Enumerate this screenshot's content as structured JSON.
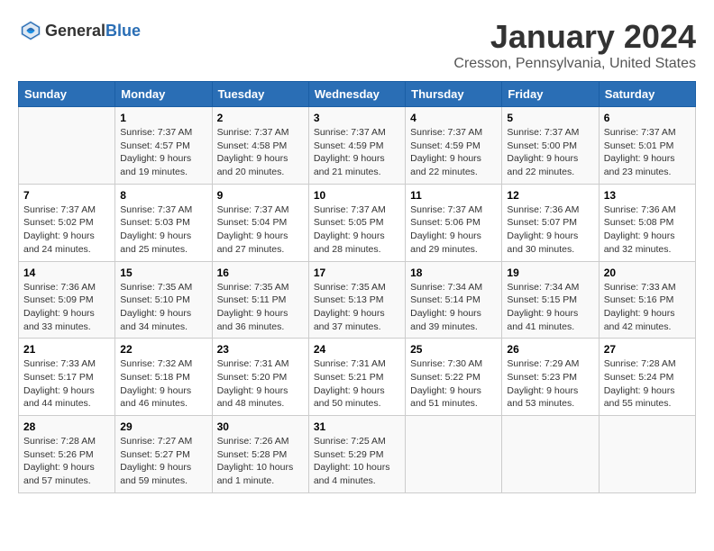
{
  "header": {
    "logo_general": "General",
    "logo_blue": "Blue",
    "title": "January 2024",
    "subtitle": "Cresson, Pennsylvania, United States"
  },
  "weekdays": [
    "Sunday",
    "Monday",
    "Tuesday",
    "Wednesday",
    "Thursday",
    "Friday",
    "Saturday"
  ],
  "weeks": [
    [
      {
        "day": "",
        "info": ""
      },
      {
        "day": "1",
        "info": "Sunrise: 7:37 AM\nSunset: 4:57 PM\nDaylight: 9 hours\nand 19 minutes."
      },
      {
        "day": "2",
        "info": "Sunrise: 7:37 AM\nSunset: 4:58 PM\nDaylight: 9 hours\nand 20 minutes."
      },
      {
        "day": "3",
        "info": "Sunrise: 7:37 AM\nSunset: 4:59 PM\nDaylight: 9 hours\nand 21 minutes."
      },
      {
        "day": "4",
        "info": "Sunrise: 7:37 AM\nSunset: 4:59 PM\nDaylight: 9 hours\nand 22 minutes."
      },
      {
        "day": "5",
        "info": "Sunrise: 7:37 AM\nSunset: 5:00 PM\nDaylight: 9 hours\nand 22 minutes."
      },
      {
        "day": "6",
        "info": "Sunrise: 7:37 AM\nSunset: 5:01 PM\nDaylight: 9 hours\nand 23 minutes."
      }
    ],
    [
      {
        "day": "7",
        "info": "Sunrise: 7:37 AM\nSunset: 5:02 PM\nDaylight: 9 hours\nand 24 minutes."
      },
      {
        "day": "8",
        "info": "Sunrise: 7:37 AM\nSunset: 5:03 PM\nDaylight: 9 hours\nand 25 minutes."
      },
      {
        "day": "9",
        "info": "Sunrise: 7:37 AM\nSunset: 5:04 PM\nDaylight: 9 hours\nand 27 minutes."
      },
      {
        "day": "10",
        "info": "Sunrise: 7:37 AM\nSunset: 5:05 PM\nDaylight: 9 hours\nand 28 minutes."
      },
      {
        "day": "11",
        "info": "Sunrise: 7:37 AM\nSunset: 5:06 PM\nDaylight: 9 hours\nand 29 minutes."
      },
      {
        "day": "12",
        "info": "Sunrise: 7:36 AM\nSunset: 5:07 PM\nDaylight: 9 hours\nand 30 minutes."
      },
      {
        "day": "13",
        "info": "Sunrise: 7:36 AM\nSunset: 5:08 PM\nDaylight: 9 hours\nand 32 minutes."
      }
    ],
    [
      {
        "day": "14",
        "info": "Sunrise: 7:36 AM\nSunset: 5:09 PM\nDaylight: 9 hours\nand 33 minutes."
      },
      {
        "day": "15",
        "info": "Sunrise: 7:35 AM\nSunset: 5:10 PM\nDaylight: 9 hours\nand 34 minutes."
      },
      {
        "day": "16",
        "info": "Sunrise: 7:35 AM\nSunset: 5:11 PM\nDaylight: 9 hours\nand 36 minutes."
      },
      {
        "day": "17",
        "info": "Sunrise: 7:35 AM\nSunset: 5:13 PM\nDaylight: 9 hours\nand 37 minutes."
      },
      {
        "day": "18",
        "info": "Sunrise: 7:34 AM\nSunset: 5:14 PM\nDaylight: 9 hours\nand 39 minutes."
      },
      {
        "day": "19",
        "info": "Sunrise: 7:34 AM\nSunset: 5:15 PM\nDaylight: 9 hours\nand 41 minutes."
      },
      {
        "day": "20",
        "info": "Sunrise: 7:33 AM\nSunset: 5:16 PM\nDaylight: 9 hours\nand 42 minutes."
      }
    ],
    [
      {
        "day": "21",
        "info": "Sunrise: 7:33 AM\nSunset: 5:17 PM\nDaylight: 9 hours\nand 44 minutes."
      },
      {
        "day": "22",
        "info": "Sunrise: 7:32 AM\nSunset: 5:18 PM\nDaylight: 9 hours\nand 46 minutes."
      },
      {
        "day": "23",
        "info": "Sunrise: 7:31 AM\nSunset: 5:20 PM\nDaylight: 9 hours\nand 48 minutes."
      },
      {
        "day": "24",
        "info": "Sunrise: 7:31 AM\nSunset: 5:21 PM\nDaylight: 9 hours\nand 50 minutes."
      },
      {
        "day": "25",
        "info": "Sunrise: 7:30 AM\nSunset: 5:22 PM\nDaylight: 9 hours\nand 51 minutes."
      },
      {
        "day": "26",
        "info": "Sunrise: 7:29 AM\nSunset: 5:23 PM\nDaylight: 9 hours\nand 53 minutes."
      },
      {
        "day": "27",
        "info": "Sunrise: 7:28 AM\nSunset: 5:24 PM\nDaylight: 9 hours\nand 55 minutes."
      }
    ],
    [
      {
        "day": "28",
        "info": "Sunrise: 7:28 AM\nSunset: 5:26 PM\nDaylight: 9 hours\nand 57 minutes."
      },
      {
        "day": "29",
        "info": "Sunrise: 7:27 AM\nSunset: 5:27 PM\nDaylight: 9 hours\nand 59 minutes."
      },
      {
        "day": "30",
        "info": "Sunrise: 7:26 AM\nSunset: 5:28 PM\nDaylight: 10 hours\nand 1 minute."
      },
      {
        "day": "31",
        "info": "Sunrise: 7:25 AM\nSunset: 5:29 PM\nDaylight: 10 hours\nand 4 minutes."
      },
      {
        "day": "",
        "info": ""
      },
      {
        "day": "",
        "info": ""
      },
      {
        "day": "",
        "info": ""
      }
    ]
  ]
}
